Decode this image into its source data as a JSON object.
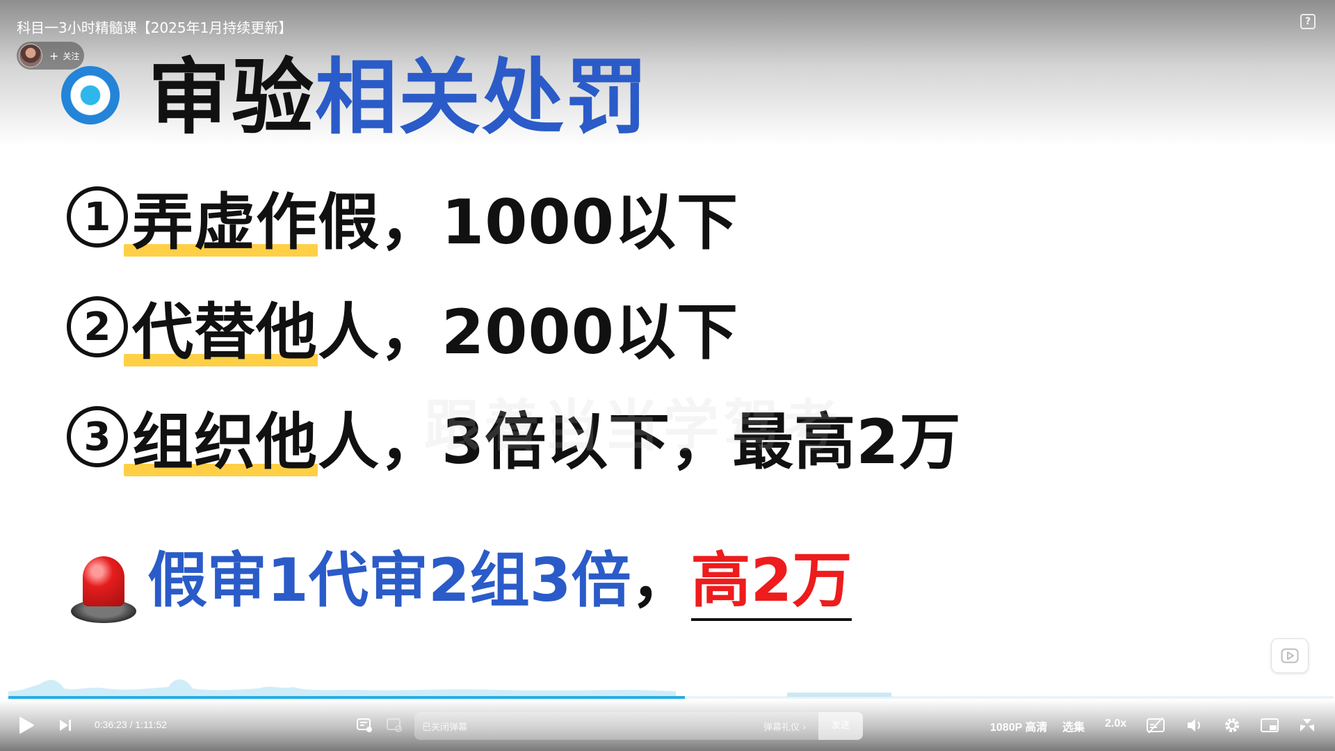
{
  "header": {
    "video_title": "科目一3小时精髓课【2025年1月持续更新】",
    "follow_label": "关注",
    "follow_plus": "+",
    "help_label": "?"
  },
  "slide": {
    "title_black": "审验",
    "title_blue": "相关处罚",
    "rules": [
      {
        "num": "1",
        "highlight": "弄虚作",
        "rest": "假，1000以下"
      },
      {
        "num": "2",
        "highlight": "代替他",
        "rest": "人，2000以下"
      },
      {
        "num": "3",
        "highlight": "组织他",
        "rest": "人，3倍以下，最高2万"
      }
    ],
    "watermark": "跟着当当学驾考",
    "mnemonic_blue": "假审1代审2组3倍",
    "mnemonic_comma": "，",
    "mnemonic_red": "高2万"
  },
  "player": {
    "progress_fraction": 0.5107,
    "current_time": "0:36:23",
    "time_separator": "/",
    "total_time": "1:11:52",
    "danmaku_placeholder": "已关闭弹幕",
    "danmaku_etiquette": "弹幕礼仪 ›",
    "send_label": "发送",
    "quality_label": "1080P 高清",
    "episodes_label": "选集",
    "speed_label": "2.0x"
  },
  "colors": {
    "accent_blue": "#2a5bc8",
    "highlight_yellow": "#ffcf45",
    "alert_red": "#ee1c1c",
    "progress_blue": "#23ade5"
  }
}
